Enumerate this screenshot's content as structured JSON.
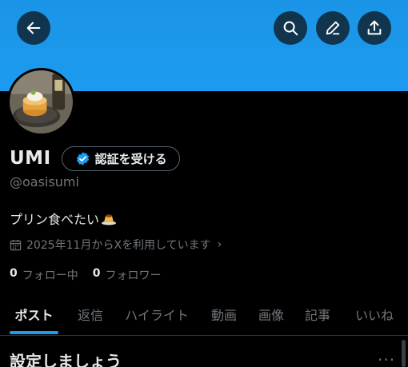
{
  "header": {
    "back_label": "back",
    "search_label": "search",
    "edit_label": "edit",
    "share_label": "share"
  },
  "colors": {
    "banner": "#1d9bf0",
    "accent": "#1d9bf0",
    "background": "#000000",
    "secondary_text": "#71767b"
  },
  "profile": {
    "display_name": "UMI",
    "verify_button_label": "認証を受ける",
    "handle": "@oasisumi",
    "bio_text": "プリン食べたい",
    "bio_emoji_icon": "pudding-emoji-icon",
    "joined_text": "2025年11月からXを利用しています",
    "following_count": "0",
    "following_label": "フォロー中",
    "followers_count": "0",
    "followers_label": "フォロワー"
  },
  "tabs": [
    {
      "label": "ポスト",
      "active": true
    },
    {
      "label": "返信",
      "active": false
    },
    {
      "label": "ハイライト",
      "active": false
    },
    {
      "label": "動画",
      "active": false
    },
    {
      "label": "画像",
      "active": false
    },
    {
      "label": "記事",
      "active": false
    },
    {
      "label": "いいね",
      "active": false
    }
  ],
  "setup": {
    "title": "設定しましょう",
    "more_icon": "more-horizontal-icon"
  }
}
